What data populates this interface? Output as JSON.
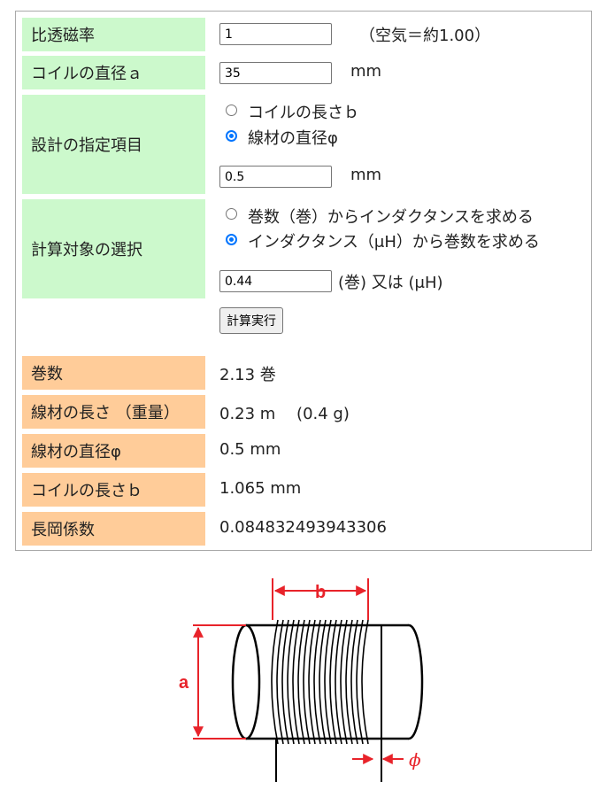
{
  "form": {
    "permeability": {
      "label": "比透磁率",
      "value": "1",
      "note": "（空気＝約1.00）"
    },
    "coil_diameter": {
      "label": "コイルの直径ａ",
      "value": "35",
      "unit": "mm"
    },
    "design_spec": {
      "label": "設計の指定項目",
      "options": [
        "コイルの長さｂ",
        "線材の直径φ"
      ],
      "selected_index": 1,
      "value": "0.5",
      "unit": "mm"
    },
    "calc_target": {
      "label": "計算対象の選択",
      "options": [
        "巻数（巻）からインダクタンスを求める",
        "インダクタンス（μH）から巻数を求める"
      ],
      "selected_index": 1,
      "value": "0.44",
      "unit": "(巻) 又は (μH)"
    },
    "run_button": "計算実行"
  },
  "results": [
    {
      "label": "巻数",
      "value": "2.13 巻"
    },
    {
      "label": "線材の長さ （重量）",
      "value": "0.23 m　 (0.4 g)"
    },
    {
      "label": "線材の直径φ",
      "value": "0.5 mm"
    },
    {
      "label": "コイルの長さｂ",
      "value": "1.065 mm"
    },
    {
      "label": "長岡係数",
      "value": "0.084832493943306"
    }
  ],
  "diagram": {
    "label_a": "a",
    "label_b": "b",
    "label_phi": "ϕ",
    "accent_color": "#e8232a"
  }
}
